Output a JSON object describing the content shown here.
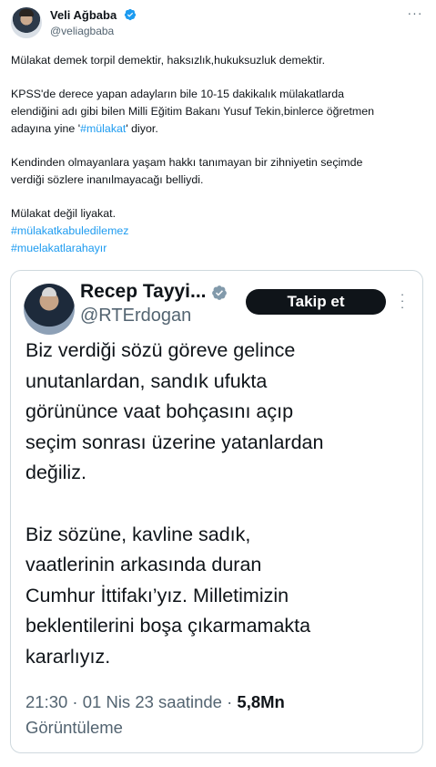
{
  "author": {
    "name": "Veli Ağbaba",
    "handle": "@veliagbaba",
    "more_label": "···"
  },
  "tweet": {
    "p1": "Mülakat demek torpil demektir, haksızlık,hukuksuzluk demektir.",
    "p2_line1": "KPSS'de derece yapan adayların bile 10-15 dakikalık mülakatlarda",
    "p2_line2": "elendiğini adı gibi bilen Milli Eğitim Bakanı Yusuf Tekin,binlerce öğretmen",
    "p2_line3_before": "adayına yine '",
    "p2_line3_tag": "#mülakat",
    "p2_line3_after": "' diyor.",
    "p3_line1": "Kendinden olmayanlara yaşam hakkı tanımayan bir zihniyetin seçimde",
    "p3_line2": "verdiği sözlere inanılmayacağı belliydi.",
    "p4": "Mülakat değil liyakat.",
    "hashtag1": "#mülakatkabuledilemez",
    "hashtag2": "#muelakatlarahayır"
  },
  "quote": {
    "name": "Recep Tayyi...",
    "handle": "@RTErdogan",
    "follow_label": "Takip et",
    "text_lines_1": [
      "Biz verdiği sözü göreve gelince",
      "unutanlardan, sandık ufukta",
      "görününce vaat bohçasını açıp",
      "seçim sonrası üzerine yatanlardan",
      "değiliz."
    ],
    "text_lines_2": [
      "Biz sözüne, kavline sadık,",
      "vaatlerinin arkasında duran",
      "Cumhur İttifakı’yız. Milletimizin",
      "beklentilerini boşa çıkarmamakta",
      "kararlıyız."
    ],
    "time": "21:30 · 01 Nis 23 saatinde · ",
    "views_count": "5,8Mn",
    "views_label": "Görüntüleme"
  },
  "colors": {
    "link": "#1d9bf0",
    "verified": "#1d9bf0",
    "muted": "#536471",
    "text": "#0f1419",
    "border": "#cfd9de"
  },
  "icons": [
    "verified-badge-icon",
    "more-options-icon"
  ]
}
